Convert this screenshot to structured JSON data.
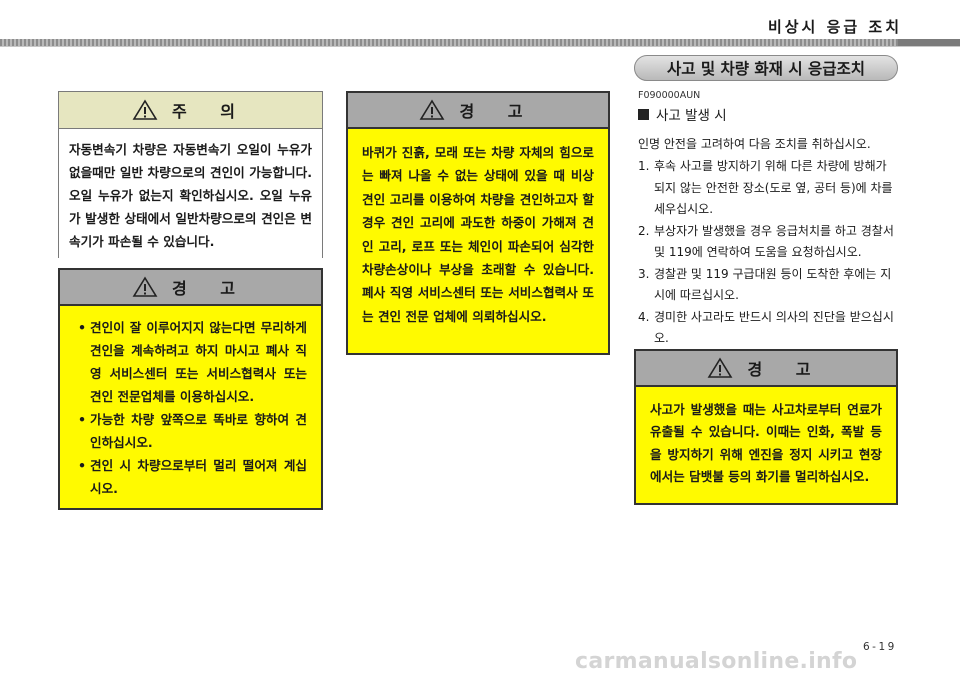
{
  "header": {
    "title": "비상시 응급 조치"
  },
  "caution_box": {
    "title": "주 의",
    "text": "자동변속기 차량은 자동변속기 오일이 누유가 없을때만 일반 차량으로의 견인이 가능합니다. 오일 누유가 없는지 확인하십시오. 오일 누유가 발생한 상태에서 일반차량으로의 견인은 변속기가 파손될 수 있습니다."
  },
  "warning_box_1": {
    "title": "경 고",
    "items": [
      "견인이 잘 이루어지지 않는다면 무리하게 견인을 계속하려고 하지 마시고 폐사 직영 서비스센터 또는 서비스협력사 또는 견인 전문업체를 이용하십시오.",
      "가능한 차량 앞쪽으로 똑바로 향하여 견인하십시오.",
      "견인 시 차량으로부터 멀리 떨어져 계십시오."
    ]
  },
  "warning_box_2": {
    "title": "경 고",
    "text": "바퀴가 진흙, 모래 또는 차량 자체의 힘으로는 빠져 나올 수 없는 상태에 있을 때 비상 견인 고리를 이용하여 차량을 견인하고자 할 경우 견인 고리에 과도한 하중이 가해져 견인 고리, 로프 또는 체인이 파손되어 심각한 차량손상이나 부상을 초래할 수 있습니다. 폐사 직영 서비스센터 또는 서비스협력사 또는 견인 전문 업체에 의뢰하십시오."
  },
  "section": {
    "title": "사고 및 차량 화재 시 응급조치",
    "code": "F090000AUN",
    "subheading": "사고 발생 시",
    "intro": "인명 안전을 고려하여 다음 조치를 취하십시오.",
    "steps": [
      {
        "num": "1.",
        "text": "후속 사고를 방지하기 위해 다른 차량에 방해가 되지 않는 안전한 장소(도로 옆, 공터 등)에 차를 세우십시오."
      },
      {
        "num": "2.",
        "text": "부상자가 발생했을 경우 응급처치를 하고 경찰서 및 119에 연락하여 도움을 요청하십시오."
      },
      {
        "num": "3.",
        "text": "경찰관 및 119 구급대원 등이 도착한 후에는 지시에 따르십시오."
      },
      {
        "num": "4.",
        "text": "경미한 사고라도 반드시 의사의 진단을 받으십시오."
      }
    ]
  },
  "warning_box_3": {
    "title": "경 고",
    "text": "사고가 발생했을 때는 사고차로부터 연료가 유출될 수 있습니다. 이때는 인화, 폭발 등을 방지하기 위해 엔진을 정지 시키고 현장에서는 담뱃불 등의 화기를 멀리하십시오."
  },
  "footer": {
    "page_number": "6-19",
    "watermark": "carmanualsonline.info"
  }
}
